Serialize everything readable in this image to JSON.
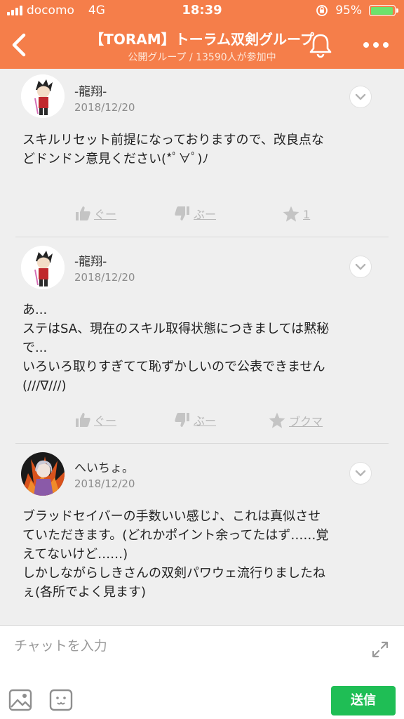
{
  "status": {
    "carrier": "docomo",
    "network": "4G",
    "time": "18:39",
    "battery": "95%",
    "battery_level": 0.95
  },
  "header": {
    "title": "【TORAM】トーラム双剣グループ",
    "subtitle": "公開グループ / 13590人が参加中"
  },
  "posts": [
    {
      "user": "-龍翔-",
      "date": "2018/12/20",
      "body": "スキルリセット前提になっておりますので、改良点な\nどドンドン意見ください(*ﾟ∀ﾟ)ﾉ",
      "like_label": "ぐー",
      "dislike_label": "ぶー",
      "star_label": "1"
    },
    {
      "user": "-龍翔-",
      "date": "2018/12/20",
      "body": "あ...\nステはSA、現在のスキル取得状態につきましては黙秘\nで...\nいろいろ取りすぎてて恥ずかしいので公表できません\n(///∇///)",
      "like_label": "ぐー",
      "dislike_label": "ぶー",
      "star_label": "ブクマ"
    },
    {
      "user": "へいちょ。",
      "date": "2018/12/20",
      "body": "ブラッドセイバーの手数いい感じ♪、これは真似させ\nていただきます。(どれかポイント余ってたはず……覚\nえてないけど……)\nしかしながらしきさんの双剣パワウェ流行りましたね\nぇ(各所でよく見ます)"
    }
  ],
  "composer": {
    "placeholder": "チャットを入力",
    "send_label": "送信"
  },
  "colors": {
    "header": "#f57e4a",
    "send": "#1fbe55",
    "background": "#efefef"
  }
}
